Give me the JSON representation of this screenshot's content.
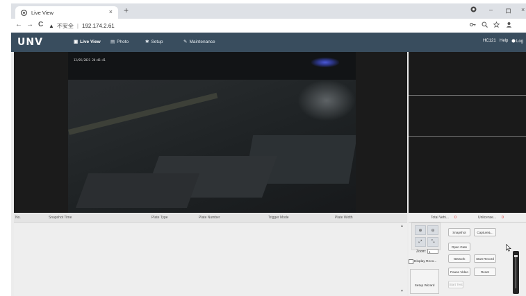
{
  "browser": {
    "tab_title": "Live View",
    "tab_close": "×",
    "new_tab": "+",
    "nav_back": "←",
    "nav_forward": "→",
    "nav_reload": "C",
    "security_warning": "▲",
    "insecure_label": "不安全",
    "separator": "|",
    "url": "192.174.2.61",
    "win_min": "–",
    "win_max": "ロ",
    "win_close": "×"
  },
  "app": {
    "logo": "UNV",
    "menu": [
      {
        "label": "Live View",
        "icon": "camera-icon",
        "glyph": "▣"
      },
      {
        "label": "Photo",
        "icon": "photo-icon",
        "glyph": "▤"
      },
      {
        "label": "Setup",
        "icon": "gear-icon",
        "glyph": "✱"
      },
      {
        "label": "Maintenance",
        "icon": "wrench-icon",
        "glyph": "✎"
      }
    ],
    "user": "HC121",
    "help": "Help",
    "logout": "Log"
  },
  "video": {
    "osd_timestamp": "13/05/2021 20:46:41"
  },
  "snapshot_table": {
    "columns": [
      "No.",
      "Snapshot Time",
      "Plate Type",
      "Plate Number",
      "Trigger Mode",
      "Plate Width"
    ],
    "rows": []
  },
  "right_panel": {
    "total_label": "Total Vehi...",
    "total_value": "0",
    "unlicense_label": "Unlicense...",
    "unlicense_value": "0",
    "zoom_label": "Zoom:",
    "zoom_value": "1",
    "buttons": {
      "snapshot": "Snapshot",
      "capture": "Capture&...",
      "open_gate": "Open Gate",
      "network": "Network",
      "start_record": "Start Record",
      "pause_video": "Pause Video",
      "reset": "Reset",
      "start_test": "Start Test"
    },
    "display_record": "Display Reco...",
    "setup_wizard": "Setup Wizard",
    "zoom_in": "⊕",
    "zoom_out": "⊖",
    "expand": "⤢",
    "shrink": "⤡"
  },
  "colors": {
    "app_bar": "#394d5e",
    "video_bg": "#1b1b1b",
    "counter_red": "#dd2222"
  }
}
